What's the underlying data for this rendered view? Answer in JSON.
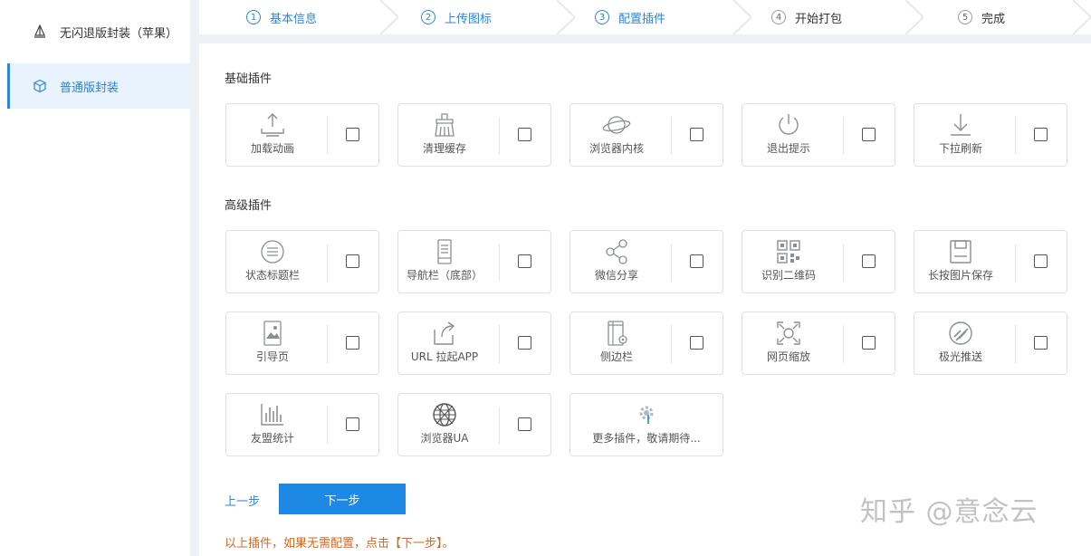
{
  "sidebar": {
    "items": [
      {
        "label": "无闪退版封装（苹果）",
        "icon": "sailboat-icon",
        "active": false
      },
      {
        "label": "普通版封装",
        "icon": "cube-icon",
        "active": true
      }
    ]
  },
  "steps": [
    {
      "num": "1",
      "label": "基本信息",
      "state": "done"
    },
    {
      "num": "2",
      "label": "上传图标",
      "state": "done"
    },
    {
      "num": "3",
      "label": "配置插件",
      "state": "done"
    },
    {
      "num": "4",
      "label": "开始打包",
      "state": "pending"
    },
    {
      "num": "5",
      "label": "完成",
      "state": "pending"
    }
  ],
  "basic": {
    "title": "基础插件",
    "plugins": [
      {
        "label": "加载动画",
        "icon": "upload-icon",
        "checked": false
      },
      {
        "label": "清理缓存",
        "icon": "broom-icon",
        "checked": false
      },
      {
        "label": "浏览器内核",
        "icon": "planet-icon",
        "checked": false
      },
      {
        "label": "退出提示",
        "icon": "power-icon",
        "checked": false
      },
      {
        "label": "下拉刷新",
        "icon": "download-arrow-icon",
        "checked": false
      }
    ]
  },
  "advanced": {
    "title": "高级插件",
    "plugins": [
      {
        "label": "状态标题栏",
        "icon": "menu-circle-icon",
        "checked": false
      },
      {
        "label": "导航栏（底部）",
        "icon": "phone-doc-icon",
        "checked": false
      },
      {
        "label": "微信分享",
        "icon": "share-icon",
        "checked": false
      },
      {
        "label": "识别二维码",
        "icon": "qrcode-icon",
        "checked": false
      },
      {
        "label": "长按图片保存",
        "icon": "save-icon",
        "checked": false
      },
      {
        "label": "引导页",
        "icon": "image-phone-icon",
        "checked": false
      },
      {
        "label": "URL 拉起APP",
        "icon": "external-link-icon",
        "checked": false
      },
      {
        "label": "侧边栏",
        "icon": "sidebar-phone-icon",
        "checked": false
      },
      {
        "label": "网页缩放",
        "icon": "zoom-frame-icon",
        "checked": false
      },
      {
        "label": "极光推送",
        "icon": "push-icon",
        "checked": false
      },
      {
        "label": "友盟统计",
        "icon": "bar-chart-icon",
        "checked": false
      },
      {
        "label": "浏览器UA",
        "icon": "globe-icon",
        "checked": false
      }
    ],
    "more": {
      "label": "更多插件，敬请期待...",
      "icon": "gear-icon"
    }
  },
  "actions": {
    "prev": "上一步",
    "next": "下一步"
  },
  "hint": "以上插件，如果无需配置，点击【下一步】。",
  "watermark": "知乎 @意念云",
  "colors": {
    "accent": "#1e88e5",
    "hint": "#e0641e",
    "icon": "#8a8f96"
  }
}
